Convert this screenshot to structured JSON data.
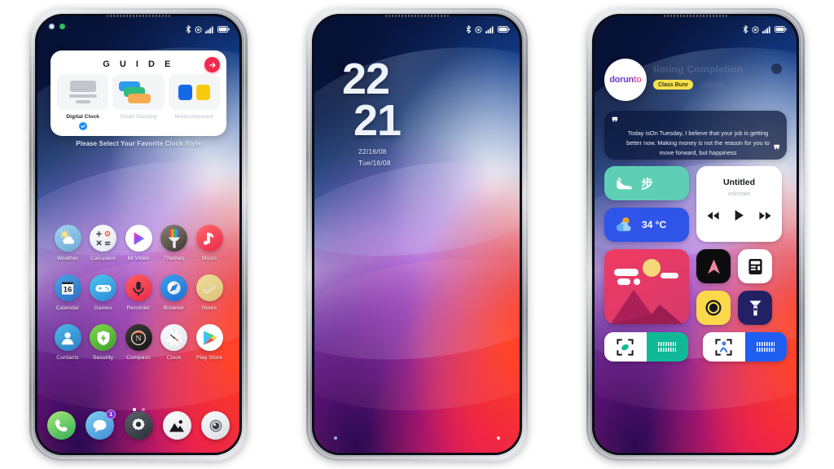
{
  "background_color": "#ffffff",
  "phones": {
    "p1": {
      "status_bar": {
        "icons": [
          "bluetooth-icon",
          "location-icon",
          "signal-icon",
          "battery-icon"
        ]
      },
      "guide_card": {
        "title": "G U I D E",
        "next_label": "→",
        "subtitle": "Please Select Your Favorite Clock Style",
        "options": [
          {
            "label": "Digital Clock",
            "selected": true,
            "thumb": "digital-clock-thumb"
          },
          {
            "label": "Smart Stacking",
            "selected": false,
            "thumb": "smart-stacking-thumb"
          },
          {
            "label": "Multicomponent",
            "selected": false,
            "thumb": "multicomponent-thumb"
          }
        ]
      },
      "apps": [
        [
          {
            "label": "Weather",
            "icon": "weather-icon"
          },
          {
            "label": "Calculator",
            "icon": "calculator-icon"
          },
          {
            "label": "Mi Video",
            "icon": "mi-video-icon"
          },
          {
            "label": "Themes",
            "icon": "themes-icon"
          },
          {
            "label": "Music",
            "icon": "music-icon"
          }
        ],
        [
          {
            "label": "Calendar",
            "icon": "calendar-icon"
          },
          {
            "label": "Games",
            "icon": "games-icon"
          },
          {
            "label": "Recorder",
            "icon": "recorder-icon"
          },
          {
            "label": "Browser",
            "icon": "browser-icon"
          },
          {
            "label": "Notes",
            "icon": "notes-icon"
          }
        ],
        [
          {
            "label": "Contacts",
            "icon": "contacts-icon"
          },
          {
            "label": "Security",
            "icon": "security-icon"
          },
          {
            "label": "Compass",
            "icon": "compass-icon"
          },
          {
            "label": "Clock",
            "icon": "clock-icon"
          },
          {
            "label": "Play Store",
            "icon": "play-store-icon"
          }
        ]
      ],
      "calendar_day": "16",
      "page_dots": {
        "count": 2,
        "active_index": 0
      },
      "dock": [
        {
          "icon": "phone-icon",
          "badge": ""
        },
        {
          "icon": "messages-icon",
          "badge": "1"
        },
        {
          "icon": "settings-icon",
          "badge": ""
        },
        {
          "icon": "gallery-icon",
          "badge": ""
        },
        {
          "icon": "camera-icon",
          "badge": ""
        }
      ]
    },
    "p2": {
      "status_bar": {
        "icons": [
          "bluetooth-icon",
          "location-icon",
          "signal-icon",
          "battery-icon"
        ]
      },
      "clock": {
        "hours": "22",
        "minutes": "21",
        "date_line1": "22/16/08",
        "date_line2": "Tue/16/08"
      }
    },
    "p3": {
      "status_bar": {
        "icons": [
          "bluetooth-icon",
          "location-icon",
          "signal-icon",
          "battery-icon"
        ]
      },
      "profile": {
        "avatar_primary": "dorun",
        "avatar_secondary": "to",
        "name": "timing Completion",
        "badge": "Class Bunr",
        "sub": "continue"
      },
      "quote": {
        "open_mark": "❞",
        "close_mark": "❞",
        "text": "Today isOn Tuesday, I believe that your job is getting better now. Making money is not the reason for you to move forward, but happiness"
      },
      "widgets": {
        "steps": {
          "icon": "shoe-icon",
          "value": "步"
        },
        "weather": {
          "icon": "sun-cloud-icon",
          "value": "34 °C"
        },
        "music": {
          "title": "Untitled",
          "artist": "unknown",
          "prev_icon": "rewind-icon",
          "play_icon": "play-icon",
          "next_icon": "forward-icon"
        },
        "photo": {
          "icon": "photo-icon"
        },
        "nav": {
          "icon": "navigation-icon"
        },
        "calculator": {
          "icon": "calculator-icon"
        },
        "camera": {
          "icon": "camera-icon"
        },
        "flashlight": {
          "icon": "flashlight-icon"
        },
        "scan_left": {
          "icon": "scan-icon",
          "right_icon": "barcode-icon"
        },
        "scan_right": {
          "icon": "scan-person-icon",
          "right_icon": "barcode-icon"
        }
      }
    }
  },
  "colors": {
    "accent_red": "#f2294b",
    "accent_blue": "#1f8df5",
    "badge_yellow": "#f5e14e",
    "teal": "#11b898",
    "music_blue": "#1f5ef0"
  }
}
